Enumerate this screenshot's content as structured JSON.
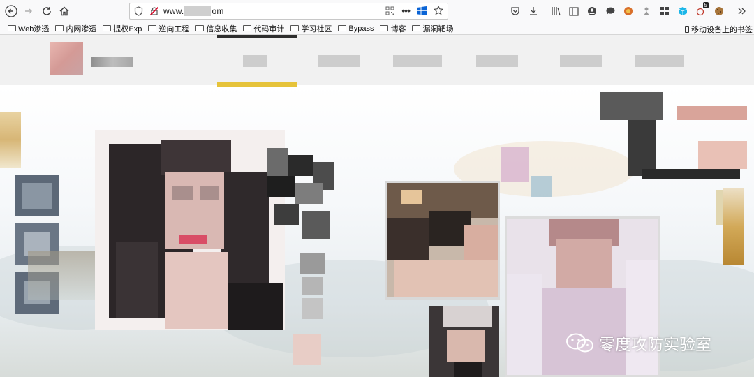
{
  "browser": {
    "url_prefix": "www.",
    "url_suffix": "om",
    "toolbar_badge": "5"
  },
  "bookmarks": [
    {
      "label": "Web渗透"
    },
    {
      "label": "内网渗透"
    },
    {
      "label": "提权Exp"
    },
    {
      "label": "逆向工程"
    },
    {
      "label": "信息收集"
    },
    {
      "label": "代码审计"
    },
    {
      "label": "学习社区"
    },
    {
      "label": "Bypass"
    },
    {
      "label": "博客"
    },
    {
      "label": "漏洞靶场"
    }
  ],
  "mobile_bookmarks": "移动设备上的书签",
  "watermark": {
    "text": "零度攻防实验室"
  },
  "colors": {
    "accent_underline": "#2e2e2e",
    "active_strip": "#e6c33a",
    "header_bg": "#f1f1f1"
  },
  "icons": [
    "back-arrow-icon",
    "forward-arrow-icon",
    "reload-icon",
    "home-icon",
    "shield-icon",
    "insecure-lock-icon",
    "qr-code-icon",
    "more-dots-icon",
    "windows-icon",
    "star-icon",
    "pocket-icon",
    "download-icon",
    "library-icon",
    "sidebar-icon",
    "account-icon",
    "chat-icon",
    "extension-icon",
    "tool-icon",
    "grid-icon",
    "cube-icon",
    "counter-extension-icon",
    "cookie-icon",
    "overflow-chevron-icon",
    "folder-icon",
    "phone-icon",
    "wechat-icon"
  ]
}
